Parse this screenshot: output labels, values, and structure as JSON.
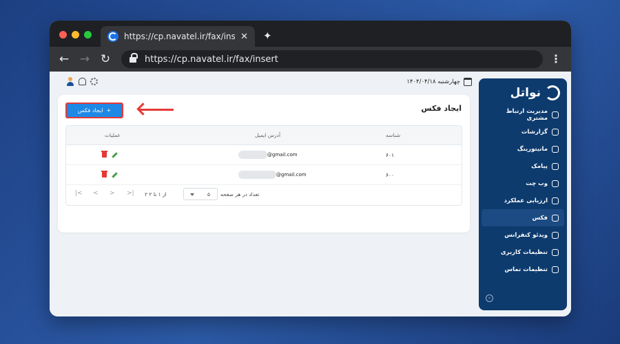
{
  "browser": {
    "tab_title": "https://cp.navatel.ir/fax/insert",
    "url": "https://cp.navatel.ir/fax/insert",
    "close_glyph": "✕",
    "newtab_glyph": "✦",
    "back_glyph": "←",
    "forward_glyph": "→",
    "reload_glyph": "↻",
    "menu_glyph": "⋮"
  },
  "brand": {
    "name": "نواتل"
  },
  "sidebar": {
    "items": [
      {
        "label": "مدیریت ارتباط مشتری",
        "icon": "users-icon"
      },
      {
        "label": "گزارشات",
        "icon": "report-icon"
      },
      {
        "label": "مانیتورینگ",
        "icon": "monitor-icon"
      },
      {
        "label": "پیامک",
        "icon": "send-icon"
      },
      {
        "label": "وب چت",
        "icon": "chat-icon"
      },
      {
        "label": "ارزیابی عملکرد",
        "icon": "clipboard-icon"
      },
      {
        "label": "فکس",
        "icon": "fax-icon",
        "active": true
      },
      {
        "label": "ویدئو کنفرانس",
        "icon": "video-icon"
      },
      {
        "label": "تنظیمات کاربری",
        "icon": "user-settings-icon"
      },
      {
        "label": "تنظیمات تماس",
        "icon": "call-settings-icon"
      }
    ],
    "collapse_glyph": "»"
  },
  "header": {
    "date": "چهارشنبه ۱۴۰۴/۰۴/۱۸"
  },
  "page": {
    "title": "ایجاد فکس",
    "create_button": "ایجاد فکس",
    "create_icon": "+"
  },
  "table": {
    "columns": {
      "id": "شناسه",
      "email": "آدرس ایمیل",
      "actions": "عملیات"
    },
    "rows": [
      {
        "id": "۶۰۱",
        "email": "@gmail.com"
      },
      {
        "id": "۶۰۰",
        "email": "@gmail.com"
      }
    ]
  },
  "pagination": {
    "rows_per_page_label": "تعداد در هر صفحه",
    "rows_per_page": "۵",
    "range": "۲ از ۱ تا ۲",
    "first": "|<",
    "prev": "<",
    "next": ">",
    "last": ">|"
  },
  "colors": {
    "accent": "#1e88e5",
    "highlight": "#e53935",
    "sidebar": "#0d3b6e"
  }
}
